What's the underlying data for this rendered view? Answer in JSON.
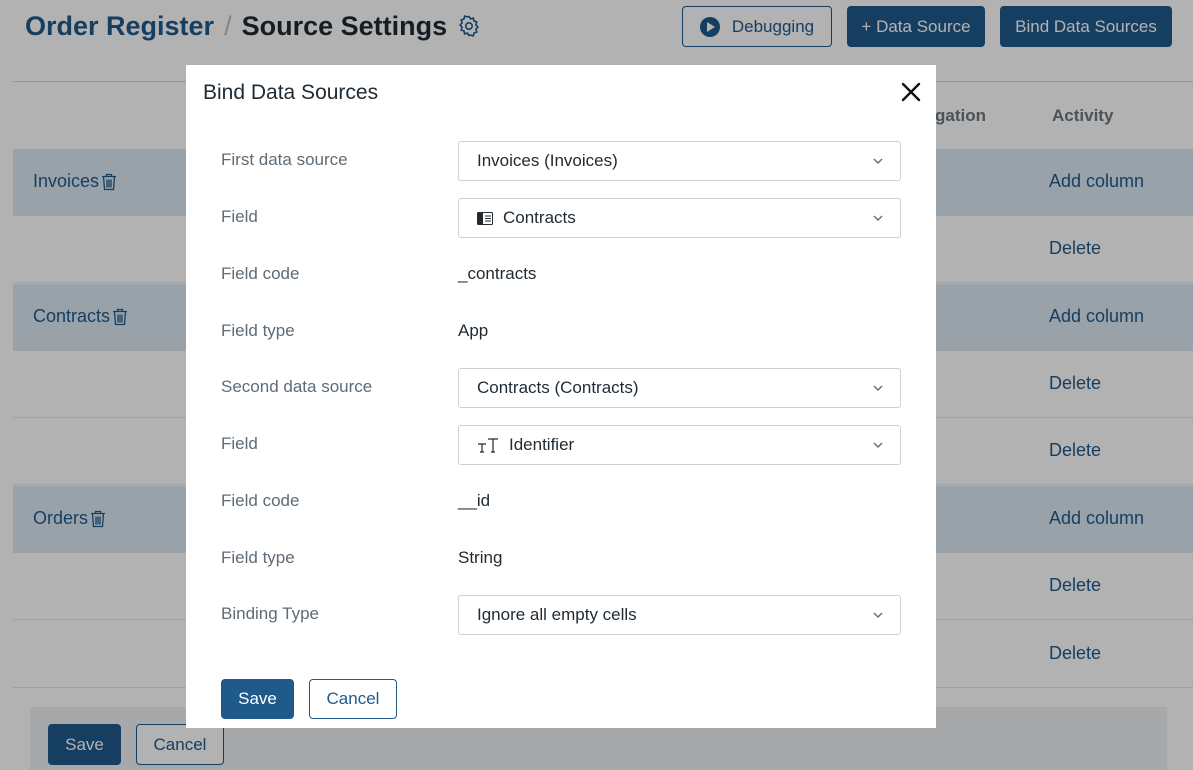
{
  "header": {
    "breadcrumb_root": "Order Register",
    "breadcrumb_separator": "/",
    "breadcrumb_current": "Source Settings",
    "debug_label": "Debugging",
    "add_source_label": "+ Data Source",
    "bind_sources_label": "Bind Data Sources"
  },
  "table": {
    "columns": {
      "aggregation": "gation",
      "activity": "Activity"
    },
    "rows": [
      {
        "name": "Invoices",
        "action": "Add column",
        "group": true
      },
      {
        "name": "",
        "action": "Delete",
        "group": false
      },
      {
        "name": "Contracts",
        "action": "Add column",
        "group": true
      },
      {
        "name": "",
        "action": "Delete",
        "group": false
      },
      {
        "name": "",
        "action": "Delete",
        "group": false
      },
      {
        "name": "Orders",
        "action": "Add column",
        "group": true
      },
      {
        "name": "",
        "action": "Delete",
        "group": false
      },
      {
        "name": "",
        "action": "Delete",
        "group": false
      }
    ]
  },
  "footer": {
    "save_label": "Save",
    "cancel_label": "Cancel"
  },
  "modal": {
    "title": "Bind Data Sources",
    "fields": {
      "first_source": {
        "label": "First data source",
        "value": "Invoices (Invoices)"
      },
      "first_field": {
        "label": "Field",
        "value": "Contracts",
        "icon": "app-icon"
      },
      "first_code": {
        "label": "Field code",
        "value": "_contracts"
      },
      "first_type": {
        "label": "Field type",
        "value": "App"
      },
      "second_source": {
        "label": "Second data source",
        "value": "Contracts (Contracts)"
      },
      "second_field": {
        "label": "Field",
        "value": "Identifier",
        "icon": "text-type-icon"
      },
      "second_code": {
        "label": "Field code",
        "value": "__id"
      },
      "second_type": {
        "label": "Field type",
        "value": "String"
      },
      "binding_type": {
        "label": "Binding Type",
        "value": "Ignore all empty cells"
      }
    },
    "save_label": "Save",
    "cancel_label": "Cancel"
  },
  "colors": {
    "primary": "#1f5a8b",
    "group_row": "#dbe8f3",
    "overlay": "rgba(0,0,0,0.30)"
  }
}
